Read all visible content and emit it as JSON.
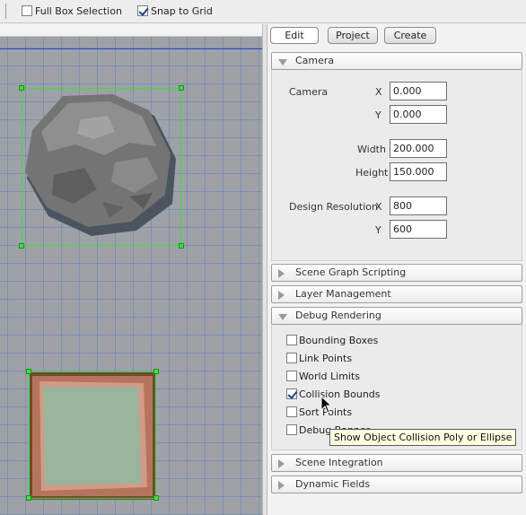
{
  "toolbar": {
    "full_box_selection": {
      "label": "Full Box Selection",
      "checked": false
    },
    "snap_to_grid": {
      "label": "Snap to Grid",
      "checked": true
    }
  },
  "panel_tabs": [
    {
      "label": "Edit",
      "active": true
    },
    {
      "label": "Project",
      "active": false
    },
    {
      "label": "Create",
      "active": false
    }
  ],
  "sections": {
    "camera": {
      "title": "Camera",
      "expanded": true
    },
    "scene_graph_scripting": {
      "title": "Scene Graph Scripting",
      "expanded": false
    },
    "layer_management": {
      "title": "Layer Management",
      "expanded": false
    },
    "debug_rendering": {
      "title": "Debug Rendering",
      "expanded": true
    },
    "scene_integration": {
      "title": "Scene Integration",
      "expanded": false
    },
    "dynamic_fields": {
      "title": "Dynamic Fields",
      "expanded": false
    }
  },
  "camera": {
    "camera_label": "Camera",
    "x_label": "X",
    "x_value": "0.000",
    "y_label": "Y",
    "y_value": "0.000",
    "width_label": "Width",
    "width_value": "200.000",
    "height_label": "Height",
    "height_value": "150.000",
    "design_resolution_label": "Design Resolution",
    "res_x_label": "X",
    "res_x_value": "800",
    "res_y_label": "Y",
    "res_y_value": "600"
  },
  "debug_rendering": {
    "items": [
      {
        "label": "Bounding Boxes",
        "checked": false
      },
      {
        "label": "Link Points",
        "checked": false
      },
      {
        "label": "World Limits",
        "checked": false
      },
      {
        "label": "Collision Bounds",
        "checked": true
      },
      {
        "label": "Sort Points",
        "checked": false
      },
      {
        "label": "Debug Banner",
        "checked": false
      }
    ]
  },
  "tooltip": "Show Object Collision Poly or Ellipse",
  "colors": {
    "canvas_bg": "#9ea2a7",
    "grid_line": "#466ebe",
    "selection": "#39e039",
    "tooltip_bg": "#ffffe1"
  },
  "icons": [
    "checkbox-icon",
    "triangle-right-icon",
    "triangle-down-icon",
    "mouse-pointer-icon"
  ]
}
